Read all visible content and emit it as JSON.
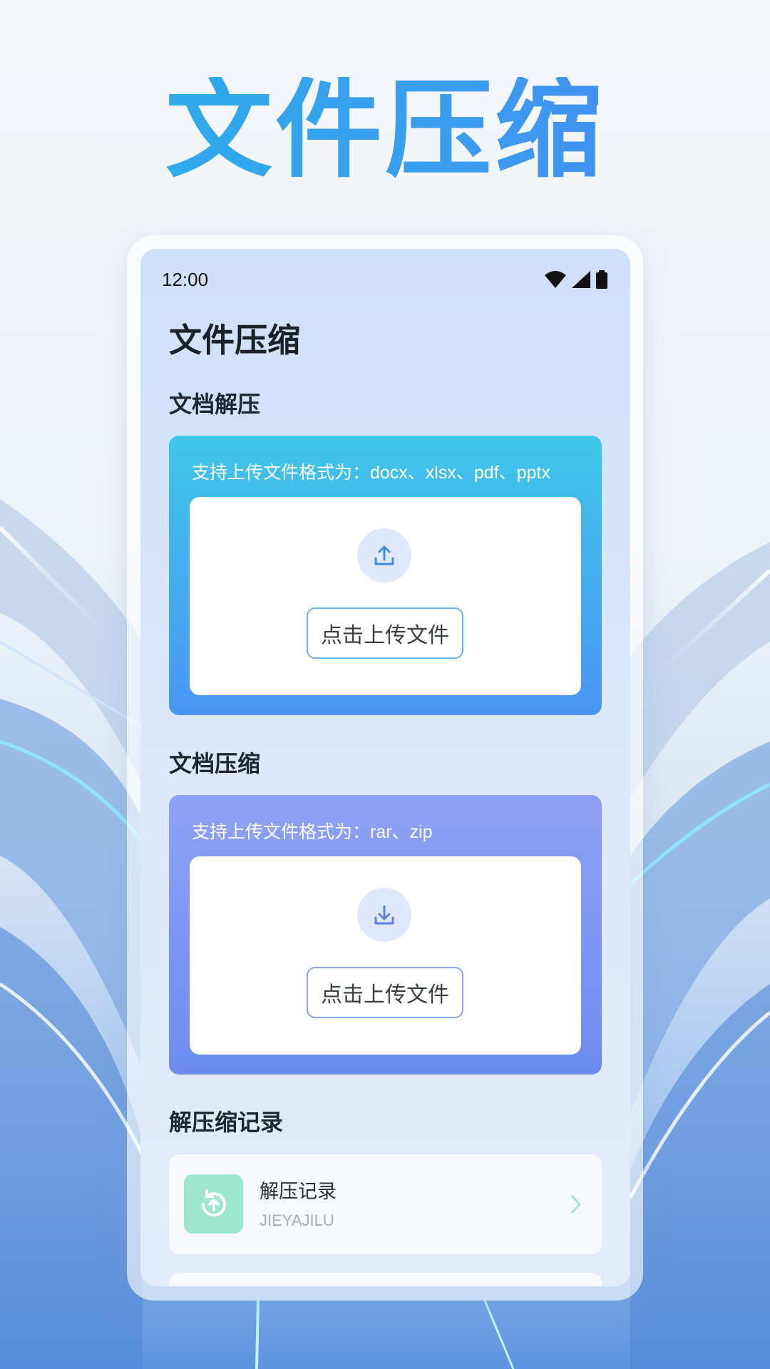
{
  "hero": {
    "title": "文件压缩"
  },
  "status_bar": {
    "time": "12:00"
  },
  "app": {
    "title": "文件压缩"
  },
  "decompress": {
    "section_title": "文档解压",
    "hint": "支持上传文件格式为：docx、xlsx、pdf、pptx",
    "button_label": "点击上传文件",
    "icon": "upload-icon"
  },
  "compress": {
    "section_title": "文档压缩",
    "hint": "支持上传文件格式为：rar、zip",
    "button_label": "点击上传文件",
    "icon": "download-icon"
  },
  "records": {
    "section_title": "解压缩记录",
    "items": [
      {
        "title": "解压记录",
        "subtitle": "JIEYAJILU",
        "icon": "history-upload-icon"
      }
    ]
  },
  "colors": {
    "hero_gradient_start": "#2ab3e8",
    "hero_gradient_end": "#4a86f2",
    "card_blue_start": "#3fc6ea",
    "card_blue_end": "#4a96f3",
    "card_purple_start": "#8fa1f6",
    "card_purple_end": "#6d8cf0",
    "record_icon_bg": "#9fe6cf"
  }
}
